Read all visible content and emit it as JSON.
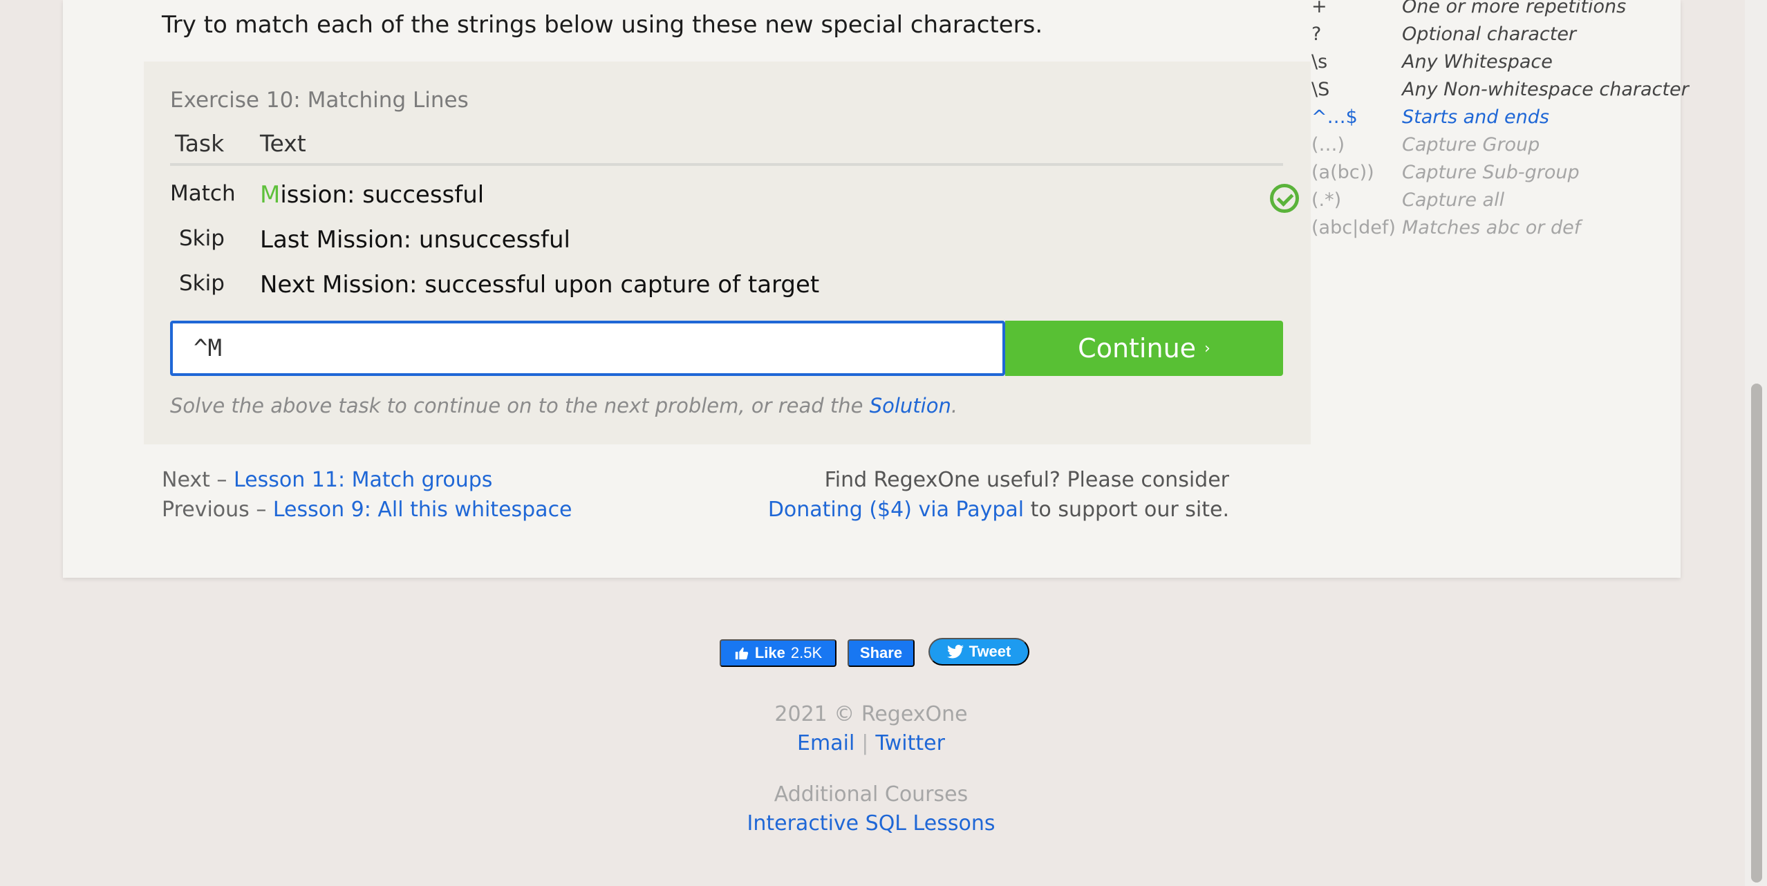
{
  "intro": "Try to match each of the strings below using these new special characters.",
  "exercise": {
    "title": "Exercise 10: Matching Lines",
    "columns": {
      "task": "Task",
      "text": "Text"
    },
    "rows": [
      {
        "task": "Match",
        "first_char": "M",
        "rest": "ission: successful",
        "status": "matched"
      },
      {
        "task": "Skip",
        "text": "Last Mission: unsuccessful"
      },
      {
        "task": "Skip",
        "text": "Next Mission: successful upon capture of target"
      }
    ],
    "input_value": "^M",
    "continue_label": "Continue",
    "continue_arrow": "›",
    "hint_prefix": "Solve the above task to continue on to the next problem, or read the ",
    "hint_link": "Solution",
    "hint_suffix": "."
  },
  "nav": {
    "next_prefix": "Next – ",
    "next_link": "Lesson 11: Match groups",
    "prev_prefix": "Previous – ",
    "prev_link": "Lesson 9: All this whitespace"
  },
  "support": {
    "line1": "Find RegexOne useful? Please consider",
    "donate_link": "Donating ($4) via Paypal",
    "line2_suffix": " to support our site."
  },
  "cheatsheet": [
    {
      "symbol": "+",
      "desc": "One or more repetitions",
      "state": "normal"
    },
    {
      "symbol": "?",
      "desc": "Optional character",
      "state": "normal"
    },
    {
      "symbol": "\\s",
      "desc": "Any Whitespace",
      "state": "normal"
    },
    {
      "symbol": "\\S",
      "desc": "Any Non-whitespace character",
      "state": "normal"
    },
    {
      "symbol": "^…$",
      "desc": "Starts and ends",
      "state": "active"
    },
    {
      "symbol": "(…)",
      "desc": "Capture Group",
      "state": "muted"
    },
    {
      "symbol": "(a(bc))",
      "desc": "Capture Sub-group",
      "state": "muted"
    },
    {
      "symbol": "(.*)",
      "desc": "Capture all",
      "state": "muted"
    },
    {
      "symbol": "(abc|def)",
      "desc": "Matches abc or def",
      "state": "muted"
    }
  ],
  "social": {
    "like_label": "Like",
    "like_count": "2.5K",
    "share_label": "Share",
    "tweet_label": "Tweet"
  },
  "footer": {
    "copyright": "2021 © RegexOne",
    "email": "Email",
    "separator": "|",
    "twitter": "Twitter",
    "additional": "Additional Courses",
    "sql_link": "Interactive SQL Lessons"
  },
  "colors": {
    "accent": "#1f67d6",
    "success": "#58c034",
    "facebook": "#1877f2",
    "twitter": "#1d9bf0"
  }
}
